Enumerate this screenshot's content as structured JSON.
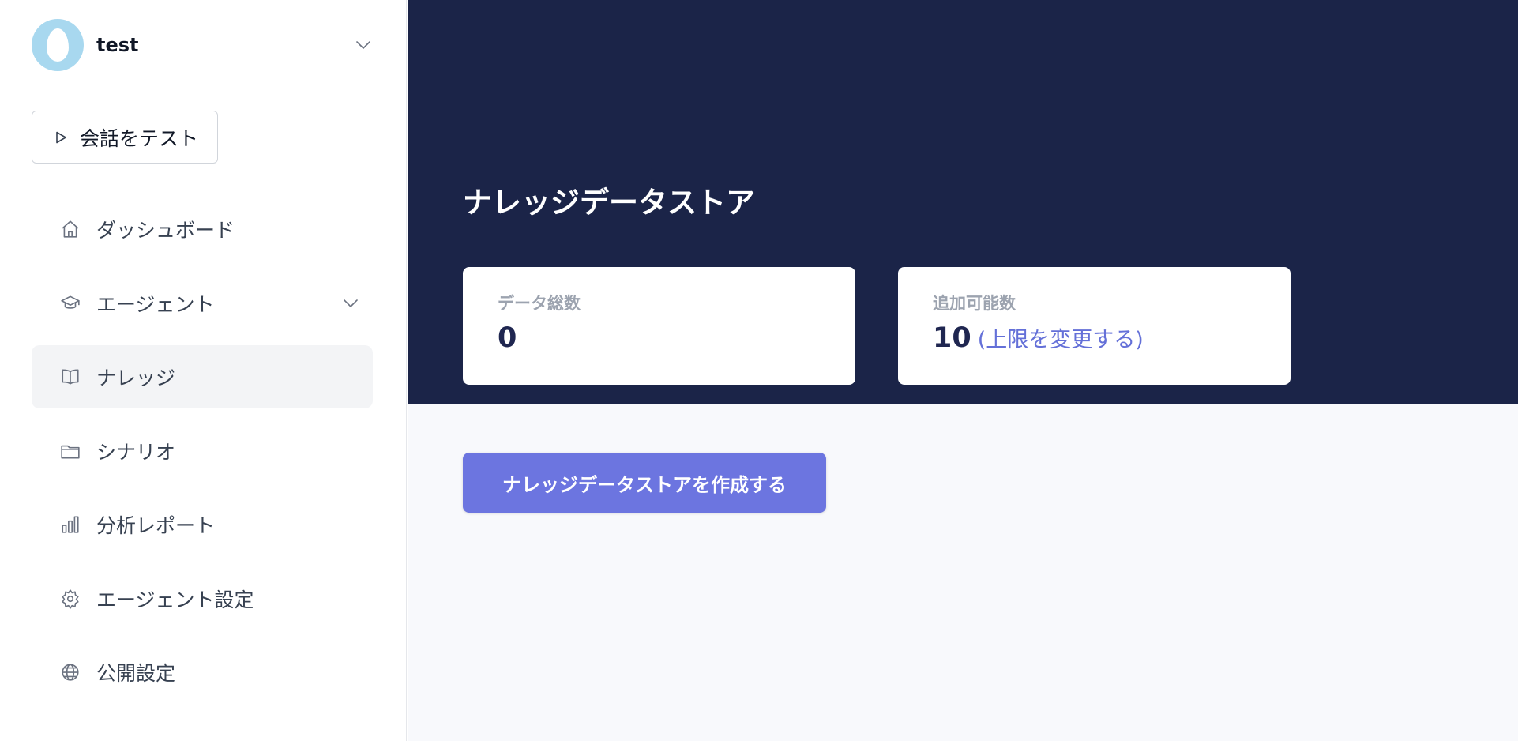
{
  "workspace": {
    "name": "test",
    "logo_color": "#a8d8ef"
  },
  "test_button": {
    "label": "会話をテスト"
  },
  "nav": {
    "items": [
      {
        "label": "ダッシュボード",
        "icon": "home-icon"
      },
      {
        "label": "エージェント",
        "icon": "graduation-cap-icon",
        "expandable": true
      },
      {
        "label": "ナレッジ",
        "icon": "book-open-icon",
        "active": true
      },
      {
        "label": "シナリオ",
        "icon": "folder-icon"
      },
      {
        "label": "分析レポート",
        "icon": "bar-chart-icon"
      },
      {
        "label": "エージェント設定",
        "icon": "gear-icon"
      },
      {
        "label": "公開設定",
        "icon": "globe-icon"
      }
    ]
  },
  "main": {
    "title": "ナレッジデータストア",
    "stats": [
      {
        "label": "データ総数",
        "value": "0"
      },
      {
        "label": "追加可能数",
        "value": "10",
        "link": "(上限を変更する)"
      }
    ],
    "create_button": "ナレッジデータストアを作成する"
  },
  "colors": {
    "hero_bg": "#1b2448",
    "accent": "#6c75e0",
    "link": "#6470d8",
    "active_nav_bg": "#f3f4f6"
  }
}
